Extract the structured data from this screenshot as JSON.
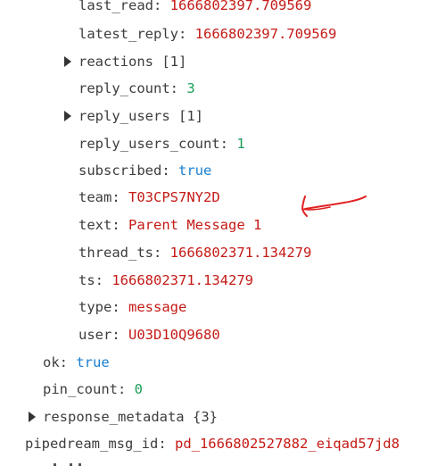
{
  "tree": {
    "last_read": {
      "key": "last_read",
      "value": "1666802397.709569"
    },
    "latest_reply": {
      "key": "latest_reply",
      "value": "1666802397.709569"
    },
    "reactions": {
      "key": "reactions",
      "meta": "[1]"
    },
    "reply_count": {
      "key": "reply_count",
      "value": "3"
    },
    "reply_users": {
      "key": "reply_users",
      "meta": "[1]"
    },
    "reply_users_count": {
      "key": "reply_users_count",
      "value": "1"
    },
    "subscribed": {
      "key": "subscribed",
      "value": "true"
    },
    "team": {
      "key": "team",
      "value": "T03CPS7NY2D"
    },
    "text": {
      "key": "text",
      "value": "Parent Message 1"
    },
    "thread_ts": {
      "key": "thread_ts",
      "value": "1666802371.134279"
    },
    "ts": {
      "key": "ts",
      "value": "1666802371.134279"
    },
    "type": {
      "key": "type",
      "value": "message"
    },
    "user": {
      "key": "user",
      "value": "U03D10Q9680"
    },
    "ok": {
      "key": "ok",
      "value": "true"
    },
    "pin_count": {
      "key": "pin_count",
      "value": "0"
    },
    "response_metadata": {
      "key": "response_metadata",
      "meta": "{3}"
    },
    "pipedream_msg_id": {
      "key": "pipedream_msg_id",
      "value": "pd_1666802527882_eiqad57jd8"
    }
  },
  "colors": {
    "string": "#c41a16",
    "number": "#1a9d5a",
    "boolean": "#1b7fd0",
    "annotation_arrow": "#e02020"
  },
  "icons": {
    "expand": "caret-right-icon",
    "annotation": "hand-drawn-arrow-icon"
  }
}
